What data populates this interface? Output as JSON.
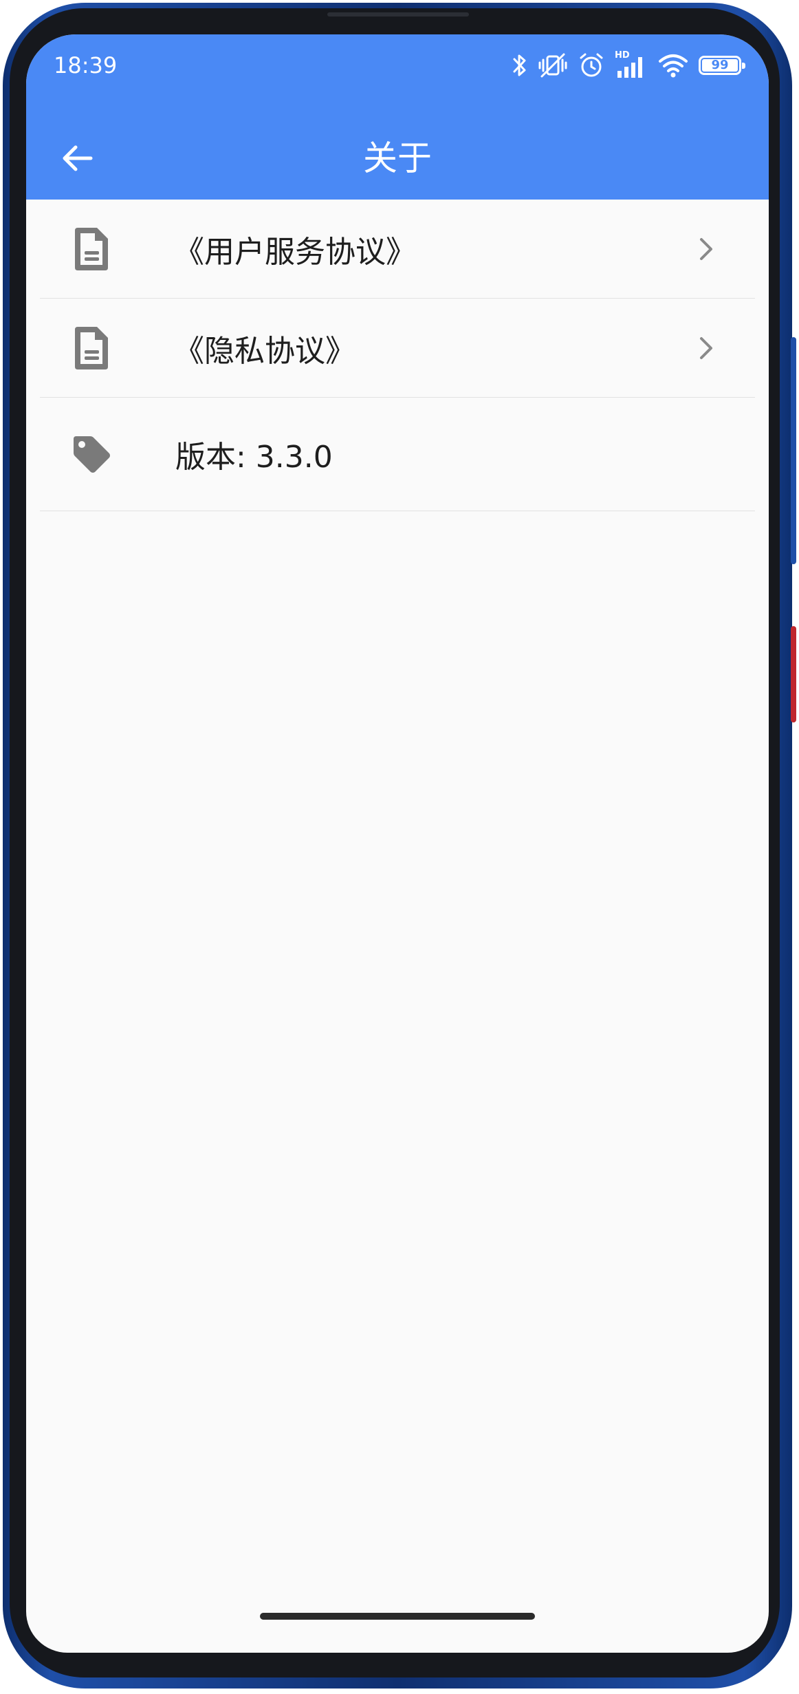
{
  "status_bar": {
    "time": "18:39",
    "network_label": "HD",
    "battery_level": "99"
  },
  "app_bar": {
    "title": "关于"
  },
  "list": {
    "items": [
      {
        "label": "《用户服务协议》",
        "icon": "document-icon",
        "has_chevron": true
      },
      {
        "label": "《隐私协议》",
        "icon": "document-icon",
        "has_chevron": true
      },
      {
        "label": "版本: 3.3.0",
        "icon": "tag-icon",
        "has_chevron": false
      }
    ]
  },
  "colors": {
    "app_bar": "#4a89f5",
    "background": "#fafafa",
    "icon_gray": "#7a7a7a",
    "divider": "#e2e2e2"
  }
}
